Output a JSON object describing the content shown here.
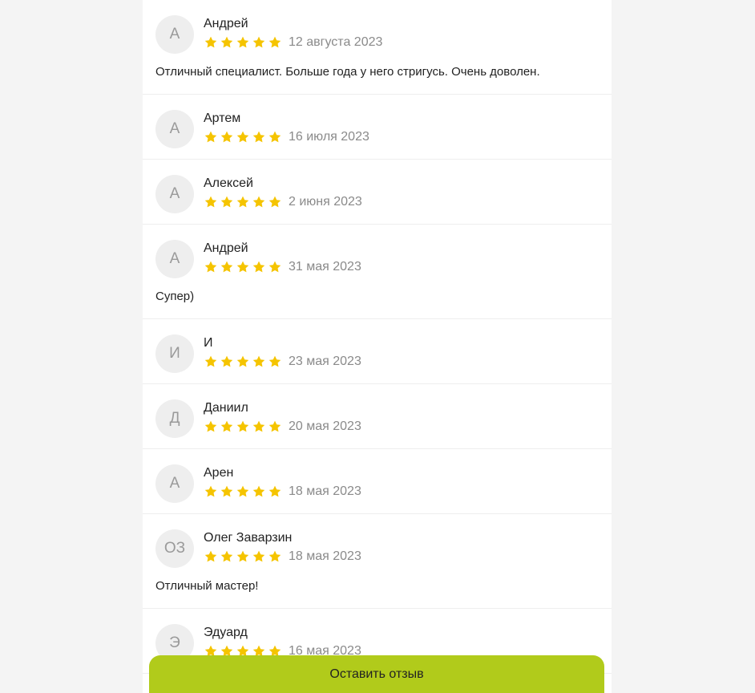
{
  "colors": {
    "accent": "#b1cb1b",
    "star": "#f5c400",
    "avatar_bg": "#eeeeee",
    "page_bg": "#f4f4f4"
  },
  "rating_icon": "star-icon",
  "reviews": [
    {
      "initials": "А",
      "name": "Андрей",
      "stars": 5,
      "date": "12 августа 2023",
      "text": "Отличный специалист. Больше года у него стригусь. Очень доволен."
    },
    {
      "initials": "А",
      "name": "Артем",
      "stars": 5,
      "date": "16 июля 2023",
      "text": ""
    },
    {
      "initials": "А",
      "name": "Алексей",
      "stars": 5,
      "date": "2 июня 2023",
      "text": ""
    },
    {
      "initials": "А",
      "name": "Андрей",
      "stars": 5,
      "date": "31 мая 2023",
      "text": "Супер)"
    },
    {
      "initials": "И",
      "name": "И",
      "stars": 5,
      "date": "23 мая 2023",
      "text": ""
    },
    {
      "initials": "Д",
      "name": "Даниил",
      "stars": 5,
      "date": "20 мая 2023",
      "text": ""
    },
    {
      "initials": "А",
      "name": "Арен",
      "stars": 5,
      "date": "18 мая 2023",
      "text": ""
    },
    {
      "initials": "ОЗ",
      "name": "Олег Заварзин",
      "stars": 5,
      "date": "18 мая 2023",
      "text": "Отличный мастер!"
    },
    {
      "initials": "Э",
      "name": "Эдуард",
      "stars": 5,
      "date": "16 мая 2023",
      "text": ""
    }
  ],
  "leave_review_button": "Оставить отзыв"
}
